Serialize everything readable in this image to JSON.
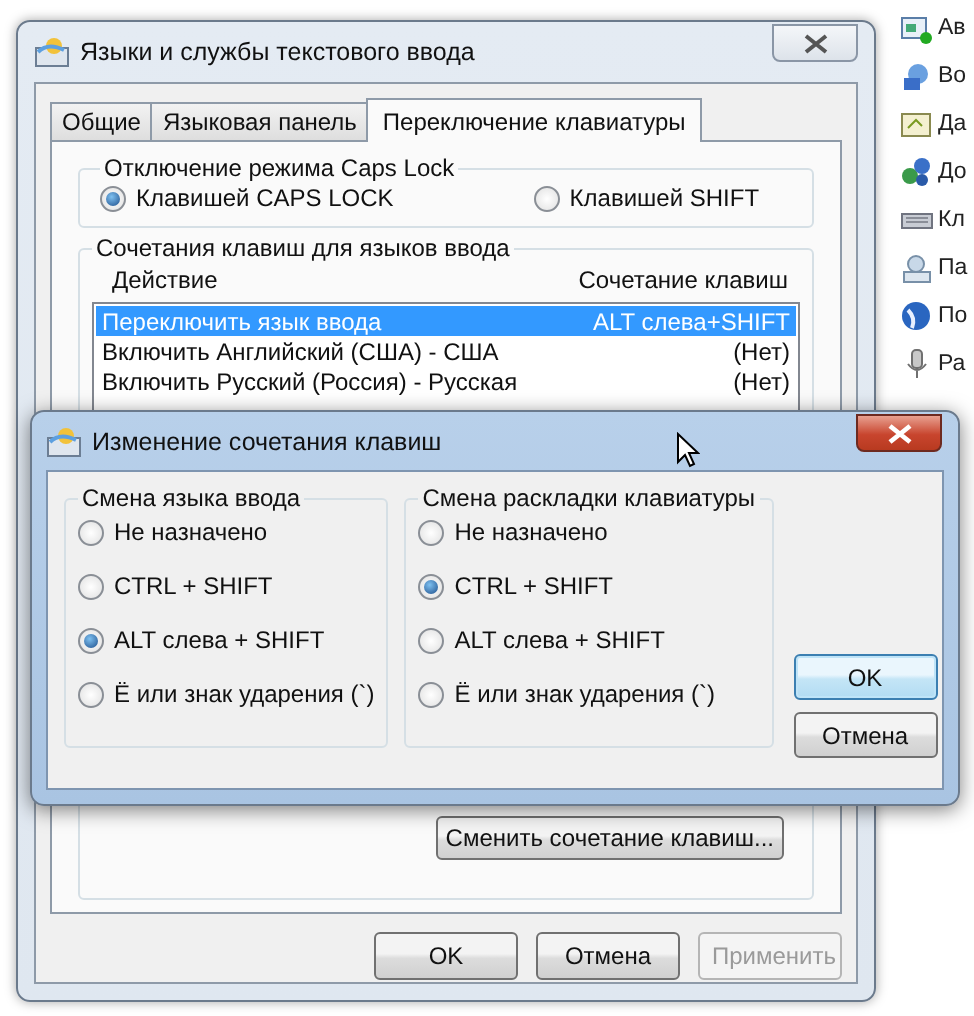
{
  "background_panel": {
    "items": [
      {
        "label": "Ав"
      },
      {
        "label": "Во"
      },
      {
        "label": "Да"
      },
      {
        "label": "До"
      },
      {
        "label": "Кл"
      },
      {
        "label": "Па"
      },
      {
        "label": "По"
      },
      {
        "label": "Ра"
      }
    ]
  },
  "main_dialog": {
    "title": "Языки и службы текстового ввода",
    "tabs": [
      {
        "label": "Общие",
        "selected": false
      },
      {
        "label": "Языковая панель",
        "selected": false
      },
      {
        "label": "Переключение клавиатуры",
        "selected": true
      }
    ],
    "caps_group": {
      "title": "Отключение режима Caps Lock",
      "options": [
        {
          "label": "Клавишей CAPS LOCK",
          "selected": true
        },
        {
          "label": "Клавишей SHIFT",
          "selected": false
        }
      ]
    },
    "hotkeys_group": {
      "title": "Сочетания клавиш для языков ввода",
      "columns": [
        "Действие",
        "Сочетание клавиш"
      ],
      "rows": [
        {
          "action": "Переключить язык ввода",
          "keys": "ALT слева+SHIFT",
          "selected": true
        },
        {
          "action": "Включить Английский (США) - США",
          "keys": "(Нет)",
          "selected": false
        },
        {
          "action": "Включить Русский (Россия) - Русская",
          "keys": "(Нет)",
          "selected": false
        }
      ],
      "change_button": "Сменить сочетание клавиш..."
    },
    "buttons": [
      {
        "label": "OK",
        "disabled": false
      },
      {
        "label": "Отмена",
        "disabled": false
      },
      {
        "label": "Применить",
        "disabled": true
      }
    ]
  },
  "change_dialog": {
    "title": "Изменение сочетания клавиш",
    "groups": [
      {
        "title": "Смена языка ввода",
        "options": [
          {
            "label": "Не назначено",
            "selected": false
          },
          {
            "label": "CTRL + SHIFT",
            "selected": false
          },
          {
            "label": "ALT слева + SHIFT",
            "selected": true
          },
          {
            "label": "Ё или знак ударения (`)",
            "selected": false
          }
        ]
      },
      {
        "title": "Смена раскладки клавиатуры",
        "options": [
          {
            "label": "Не назначено",
            "selected": false
          },
          {
            "label": "CTRL + SHIFT",
            "selected": true
          },
          {
            "label": "ALT слева + SHIFT",
            "selected": false
          },
          {
            "label": "Ё или знак ударения (`)",
            "selected": false
          }
        ]
      }
    ],
    "buttons": [
      {
        "label": "OK",
        "default": true
      },
      {
        "label": "Отмена",
        "default": false
      }
    ]
  }
}
